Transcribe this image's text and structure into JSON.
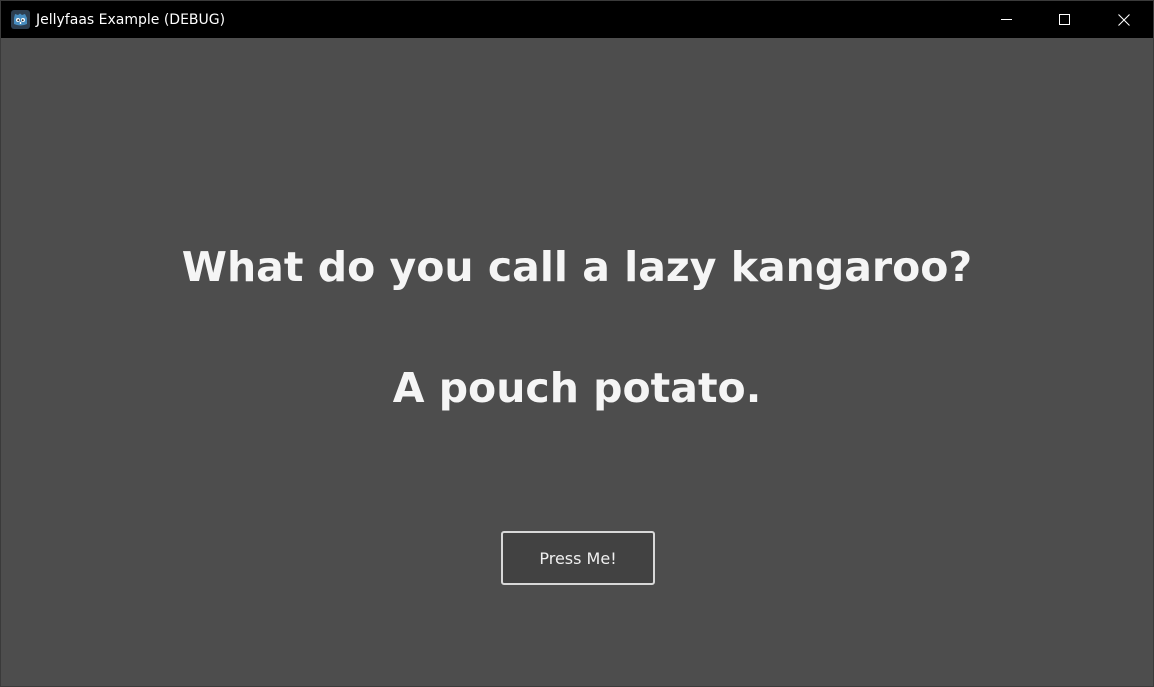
{
  "window": {
    "title": "Jellyfaas Example (DEBUG)",
    "app_icon": "godot-engine-icon",
    "controls": [
      "minimize-icon",
      "maximize-icon",
      "close-icon"
    ]
  },
  "main": {
    "question": "What do you call a lazy kangaroo?",
    "answer": "A pouch potato.",
    "button_label": "Press Me!"
  },
  "colors": {
    "titlebar": "#000000",
    "background": "#4d4d4d",
    "text": "#f5f5f5",
    "button_background": "#424242",
    "button_border": "#d8d8d8",
    "icon_blue": "#478cbf"
  }
}
